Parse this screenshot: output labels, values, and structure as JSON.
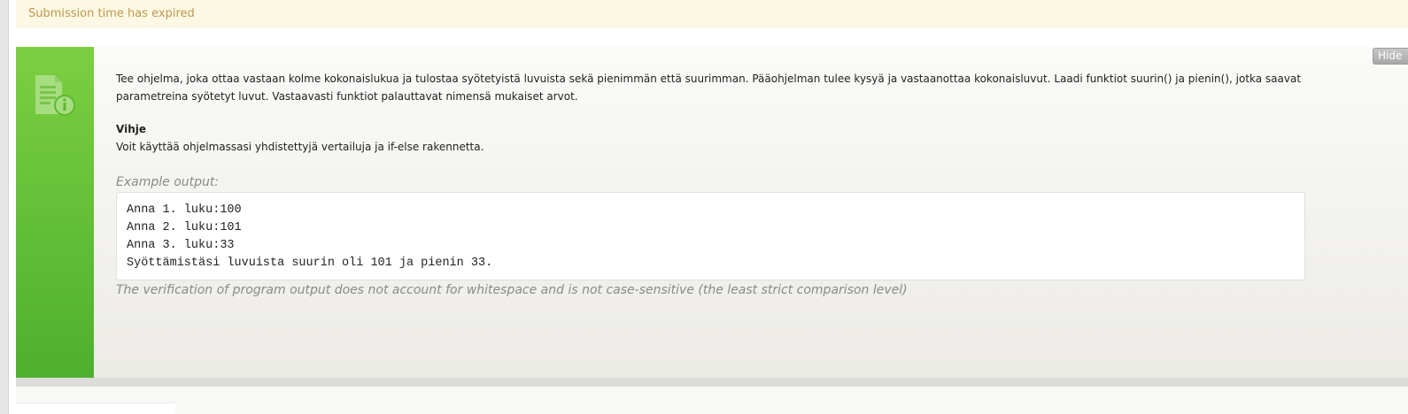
{
  "notice": {
    "text": "Submission time has expired",
    "color": "#c09853",
    "background": "#fcf8e3"
  },
  "task": {
    "icon": "document-info-icon",
    "accent_color": "#5fbd34",
    "description_1": "Tee ohjelma, joka ottaa vastaan kolme kokonaislukua ja tulostaa syötetyistä luvuista sekä pienimmän että suurimman. Pääohjelman tulee kysyä ja vastaanottaa kokonaisluvut. Laadi funktiot suurin() ja pienin(), jotka saavat",
    "description_2": "parametreina syötetyt luvut. Vastaavasti funktiot palauttavat nimensä mukaiset arvot.",
    "hint_title": "Vihje",
    "hint_text": "Voit käyttää ohjelmassasi yhdistettyjä vertailuja ja if-else rakennetta.",
    "example_label": "Example output:",
    "example_lines": [
      "Anna 1. luku:100",
      "Anna 2. luku:101",
      "Anna 3. luku:33",
      "Syöttämistäsi luvuista suurin oli 101 ja pienin 33."
    ],
    "verification_note": "The verification of program output does not account for whitespace and is not case-sensitive (the least strict comparison level)"
  },
  "hide_button": {
    "label": "Hide"
  }
}
